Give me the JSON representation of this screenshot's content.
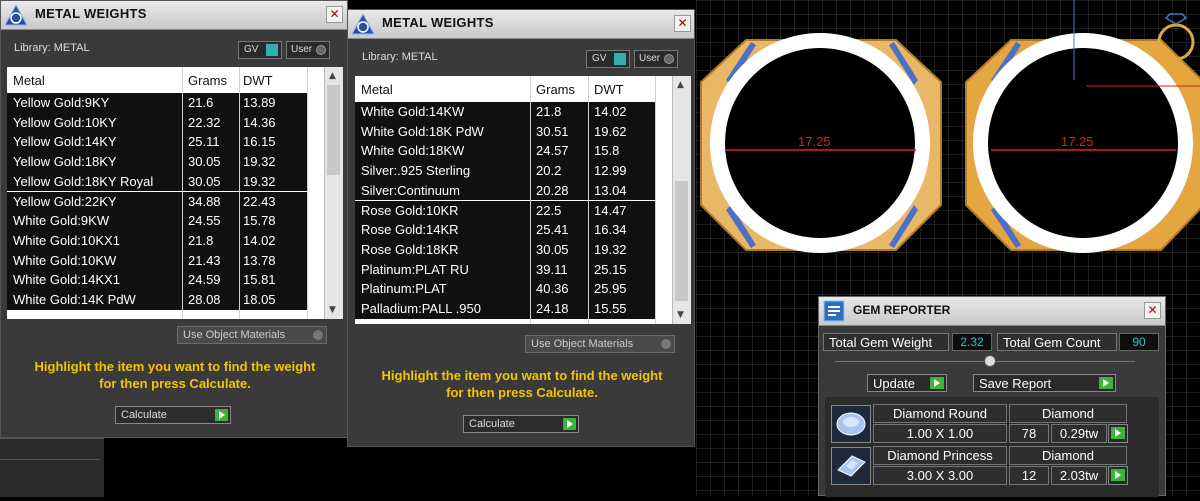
{
  "panel_left": {
    "title": "METAL WEIGHTS",
    "library_label": "Library: METAL",
    "gv_label": "GV",
    "user_label": "User",
    "columns": [
      "Metal",
      "Grams",
      "DWT"
    ],
    "rows": [
      [
        "Yellow Gold:9KY",
        "21.6",
        "13.89"
      ],
      [
        "Yellow Gold:10KY",
        "22.32",
        "14.36"
      ],
      [
        "Yellow Gold:14KY",
        "25.11",
        "16.15"
      ],
      [
        "Yellow Gold:18KY",
        "30.05",
        "19.32"
      ],
      [
        "Yellow Gold:18KY Royal",
        "30.05",
        "19.32"
      ],
      [
        "Yellow Gold:22KY",
        "34.88",
        "22.43"
      ],
      [
        "White Gold:9KW",
        "24.55",
        "15.78"
      ],
      [
        "White Gold:10KX1",
        "21.8",
        "14.02"
      ],
      [
        "White Gold:10KW",
        "21.43",
        "13.78"
      ],
      [
        "White Gold:14KX1",
        "24.59",
        "15.81"
      ],
      [
        "White Gold:14K PdW",
        "28.08",
        "18.05"
      ]
    ],
    "use_object_materials": "Use Object Materials",
    "hint_line1": "Highlight the item you want to find the weight",
    "hint_line2": "for then press Calculate.",
    "calculate_label": "Calculate"
  },
  "panel_right": {
    "title": "METAL WEIGHTS",
    "library_label": "Library: METAL",
    "gv_label": "GV",
    "user_label": "User",
    "columns": [
      "Metal",
      "Grams",
      "DWT"
    ],
    "rows": [
      [
        "White Gold:14KW",
        "21.8",
        "14.02"
      ],
      [
        "White Gold:18K PdW",
        "30.51",
        "19.62"
      ],
      [
        "White Gold:18KW",
        "24.57",
        "15.8"
      ],
      [
        "Silver:.925 Sterling",
        "20.2",
        "12.99"
      ],
      [
        "Silver:Continuum",
        "20.28",
        "13.04"
      ],
      [
        "Rose Gold:10KR",
        "22.5",
        "14.47"
      ],
      [
        "Rose Gold:14KR",
        "25.41",
        "16.34"
      ],
      [
        "Rose Gold:18KR",
        "30.05",
        "19.32"
      ],
      [
        "Platinum:PLAT RU",
        "39.11",
        "25.15"
      ],
      [
        "Platinum:PLAT",
        "40.36",
        "25.95"
      ],
      [
        "Palladium:PALL .950",
        "24.18",
        "15.55"
      ]
    ],
    "use_object_materials": "Use Object Materials",
    "hint_line1": "Highlight the item you want to find the weight",
    "hint_line2": "for then press Calculate.",
    "calculate_label": "Calculate"
  },
  "viewport": {
    "dimension_left": "17.25",
    "dimension_right": "17.25"
  },
  "gem_reporter": {
    "title": "GEM REPORTER",
    "total_weight_label": "Total Gem Weight",
    "total_weight_value": "2.32",
    "total_count_label": "Total Gem Count",
    "total_count_value": "90",
    "update_label": "Update",
    "save_report_label": "Save Report",
    "gems": [
      {
        "name": "Diamond Round",
        "material": "Diamond",
        "size": "1.00 X 1.00",
        "count": "78",
        "weight": "0.29tw"
      },
      {
        "name": "Diamond Princess",
        "material": "Diamond",
        "size": "3.00 X 3.00",
        "count": "12",
        "weight": "2.03tw"
      }
    ]
  },
  "colors": {
    "hint_yellow": "#f5c400",
    "cyan_value": "#2fc1c7",
    "go_green": "#3bb43b",
    "dimension_red": "#e0201c",
    "ring_gold": "#e3a640"
  }
}
